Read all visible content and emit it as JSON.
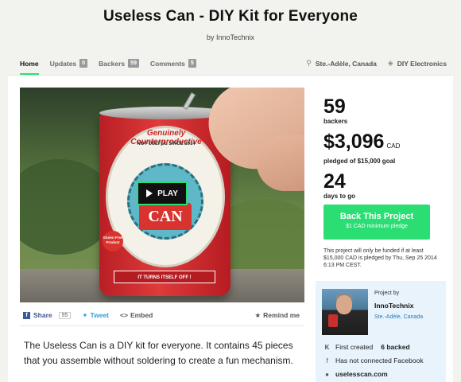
{
  "header": {
    "title": "Useless Can - DIY Kit for Everyone",
    "byline": "by InnoTechnix"
  },
  "nav": {
    "tabs": [
      {
        "label": "Home"
      },
      {
        "label": "Updates",
        "count": "0"
      },
      {
        "label": "Backers",
        "count": "59"
      },
      {
        "label": "Comments",
        "count": "5"
      }
    ],
    "location": "Ste.-Adèle, Canada",
    "category": "DIY Electronics"
  },
  "video": {
    "play_label": "PLAY",
    "can_text": {
      "arc": "Genuinely Counterproductive",
      "sub": "NOT USEFUL SINCE 2014",
      "the": "The",
      "can": "CAN",
      "bottom": "IT TURNS ITSELF OFF !",
      "badge": "Gluten Free Product"
    }
  },
  "share": {
    "facebook": "Share",
    "facebook_count": "95",
    "twitter": "Tweet",
    "embed": "Embed",
    "remind": "Remind me"
  },
  "blurb": "The Useless Can is a DIY kit for everyone. It contains 45 pieces that you assemble without soldering to create a fun mechanism.",
  "stats": {
    "backers_value": "59",
    "backers_label": "backers",
    "pledged_value": "$3,096",
    "pledged_unit": "CAD",
    "pledged_label": "pledged of $15,000 goal",
    "days_value": "24",
    "days_label": "days to go"
  },
  "back_button": {
    "label": "Back This Project",
    "sub": "$1 CAD minimum pledge"
  },
  "funding_note": "This project will only be funded if at least $15,000 CAD is pledged by Thu, Sep 25 2014 6:13 PM CEST.",
  "creator": {
    "project_by": "Project by",
    "name": "InnoTechnix",
    "location": "Ste.-Adèle, Canada",
    "first_created": "First created",
    "backed": "6 backed",
    "facebook": "Has not connected Facebook",
    "website": "uselesscan.com"
  },
  "colors": {
    "accent": "#2bde73",
    "facebook": "#3b5998",
    "twitter": "#2fa0dd",
    "link": "#2a7ab8"
  }
}
